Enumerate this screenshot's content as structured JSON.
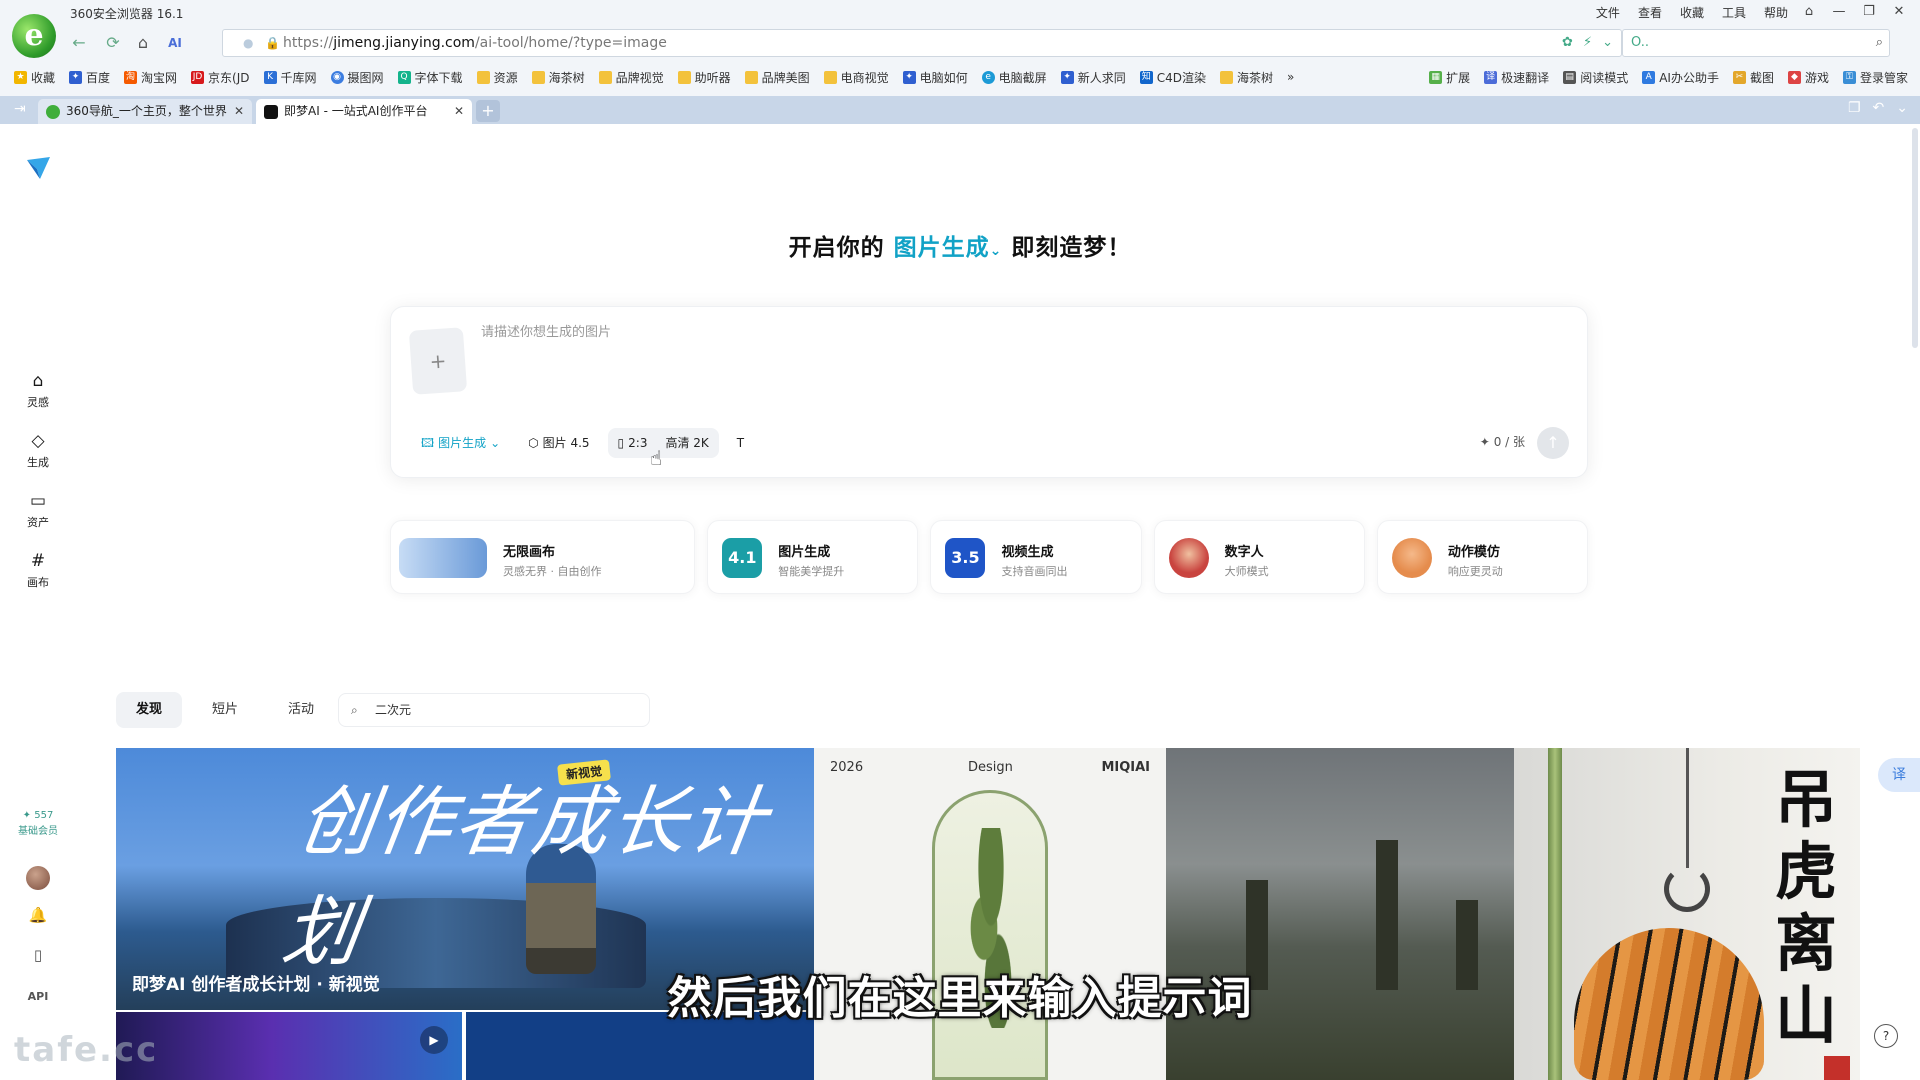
{
  "browser": {
    "title": "360安全浏览器 16.1",
    "menu": [
      "文件",
      "查看",
      "收藏",
      "工具",
      "帮助"
    ],
    "url_prefix": "https://",
    "url_host": "jimeng.jianying.com",
    "url_path": "/ai-tool/home/?type=image",
    "search_value": "O..",
    "bookmarks": [
      "收藏",
      "百度",
      "淘宝网",
      "京东(JD",
      "千库网",
      "摄图网",
      "字体下载",
      "资源",
      "海茶树",
      "品牌视觉",
      "助听器",
      "品牌美图",
      "电商视觉",
      "电脑如何",
      "电脑截屏",
      "新人求同",
      "C4D渲染",
      "海茶树"
    ],
    "bookmarks_right": [
      "扩展",
      "极速翻译",
      "阅读模式",
      "AI办公助手",
      "截图",
      "游戏",
      "登录管家"
    ],
    "tabs": [
      {
        "label": "360导航_一个主页，整个世界"
      },
      {
        "label": "即梦AI - 一站式AI创作平台"
      }
    ]
  },
  "sidebar": {
    "items": [
      {
        "label": "灵感",
        "icon": "home-icon"
      },
      {
        "label": "生成",
        "icon": "diamond-icon"
      },
      {
        "label": "资产",
        "icon": "folder-icon"
      },
      {
        "label": "画布",
        "icon": "canvas-icon"
      }
    ],
    "credits": "557",
    "membership": "基础会员",
    "api_label": "API"
  },
  "hero": {
    "prefix": "开启你的",
    "accent": "图片生成",
    "suffix": "即刻造梦！"
  },
  "prompt": {
    "placeholder": "请描述你想生成的图片",
    "upload_symbol": "+",
    "mode_label": "图片生成",
    "model_label": "图片 4.5",
    "ratio_label": "2:3",
    "quality_label": "高清 2K",
    "cost_label": "0 / 张"
  },
  "features": [
    {
      "title": "无限画布",
      "subtitle": "灵感无界 · 自由创作",
      "icon_text": "",
      "color": "#7fb2ea"
    },
    {
      "title": "图片生成",
      "subtitle": "智能美学提升",
      "icon_text": "4.1",
      "color": "#1b9ea6"
    },
    {
      "title": "视频生成",
      "subtitle": "支持音画同出",
      "icon_text": "3.5",
      "color": "#1f55c7"
    },
    {
      "title": "数字人",
      "subtitle": "大师模式",
      "icon_text": "",
      "color": "#c9443f"
    },
    {
      "title": "动作模仿",
      "subtitle": "响应更灵动",
      "icon_text": "",
      "color": "#e58c4d"
    }
  ],
  "gallery_tabs": [
    "发现",
    "短片",
    "活动"
  ],
  "gallery_search": "二次元",
  "gallery": {
    "g1_calligraphy": "创作者成长计划",
    "g1_badge": "新视觉",
    "g1_caption": "即梦AI 创作者成长计划 · 新视觉",
    "g2_year": "2026",
    "g2_design": "Design",
    "g2_brand": "MIQIAI",
    "g4_calligraphy": "吊虎离山"
  },
  "subtitle": "然后我们在这里来输入提示词",
  "watermark": "tafe.cc",
  "translate_label": "译",
  "help_label": "?"
}
